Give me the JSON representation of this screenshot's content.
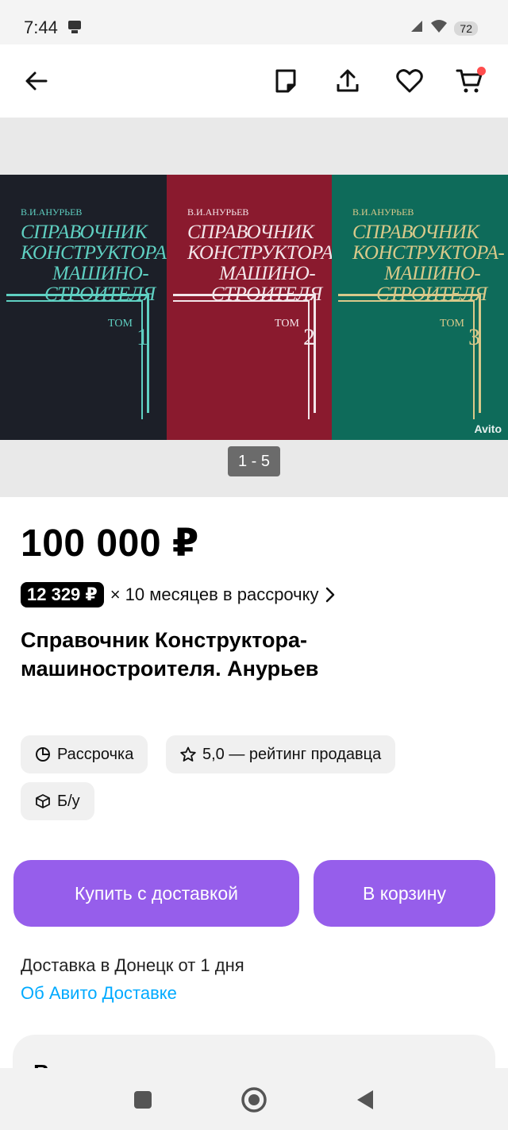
{
  "status_bar": {
    "time": "7:44",
    "battery": "72",
    "icons": [
      "notification-icon",
      "signal-icon",
      "wifi-icon",
      "battery-icon"
    ]
  },
  "header": {
    "icons": [
      "back-arrow-icon",
      "note-icon",
      "share-icon",
      "heart-icon",
      "cart-icon"
    ],
    "cart_badge_color": "#ff4d4d"
  },
  "gallery": {
    "counter": "1 - 5",
    "watermark": "Avito",
    "books": [
      {
        "author": "В.И.АНУРЬЕВ",
        "title_lines": [
          "СПРАВОЧНИК",
          "КОНСТРУКТОРА-",
          "МАШИНО-",
          "СТРОИТЕЛЯ"
        ],
        "tom": "ТОМ",
        "number": "1",
        "color": "#1c1f28",
        "ink": "#5fd0c2"
      },
      {
        "author": "В.И.АНУРЬЕВ",
        "title_lines": [
          "СПРАВОЧНИК",
          "КОНСТРУКТОРА-",
          "МАШИНО-",
          "СТРОИТЕЛЯ"
        ],
        "tom": "ТОМ",
        "number": "2",
        "color": "#8a1a2e",
        "ink": "#f3e6ea"
      },
      {
        "author": "В.И.АНУРЬЕВ",
        "title_lines": [
          "СПРАВОЧНИК",
          "КОНСТРУКТОРА-",
          "МАШИНО-",
          "СТРОИТЕЛЯ"
        ],
        "tom": "ТОМ",
        "number": "3",
        "color": "#0e6b5a",
        "ink": "#d9c98a"
      }
    ]
  },
  "listing": {
    "price": "100 000 ₽",
    "installment_amount": "12 329 ₽",
    "installment_text": "× 10 месяцев в рассрочку",
    "title": "Справочник Конструктора-машиностроителя. Анурьев",
    "chips": [
      {
        "label": "Рассрочка",
        "icon": "pie-chart-icon"
      },
      {
        "label": "5,0 — рейтинг продавца",
        "icon": "star-icon"
      },
      {
        "label": "Б/у",
        "icon": "box-icon"
      }
    ]
  },
  "actions": {
    "buy_label": "Купить с доставкой",
    "cart_label": "В корзину",
    "accent": "#965eeb"
  },
  "delivery": {
    "text": "Доставка в Донецк от 1 дня",
    "link": "Об Авито Доставке",
    "link_color": "#00aaff"
  },
  "card": {
    "title": "Возьмите в рассрочку"
  },
  "nav_bar": {
    "icons": [
      "recents-square-icon",
      "home-circle-icon",
      "back-triangle-icon"
    ]
  }
}
